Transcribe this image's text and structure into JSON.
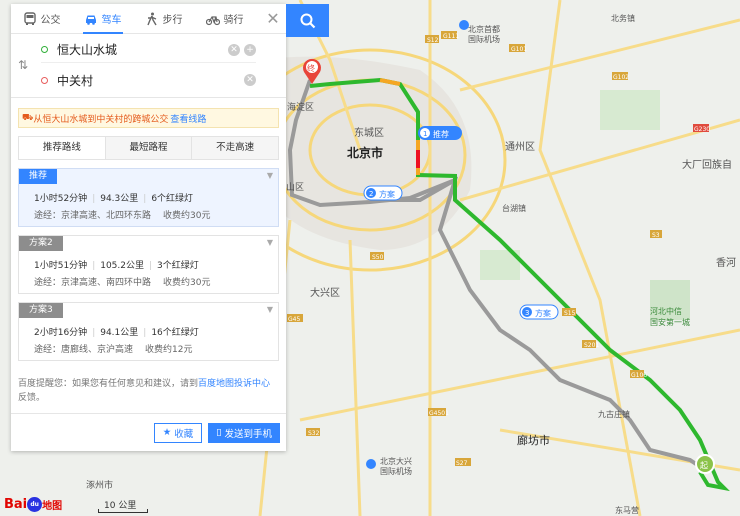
{
  "modes": [
    {
      "label": "公交",
      "icon": "bus-icon",
      "active": false
    },
    {
      "label": "驾车",
      "icon": "car-icon",
      "active": true
    },
    {
      "label": "步行",
      "icon": "walk-icon",
      "active": false
    },
    {
      "label": "骑行",
      "icon": "bike-icon",
      "active": false
    }
  ],
  "close_label": "✕",
  "search": {
    "icon": "search-icon"
  },
  "route_input": {
    "start": "恒大山水城",
    "end": "中关村",
    "start_color": "#31b03a",
    "end_color": "#e85d5d"
  },
  "notice": {
    "text": "从恒大山水城到中关村的跨城公交",
    "link": "查看线路"
  },
  "tabs": [
    "推荐路线",
    "最短路程",
    "不走高速"
  ],
  "plans": [
    {
      "tag": "推荐",
      "time": "1小时52分钟",
      "distance": "94.3公里",
      "lights": "6个红绿灯",
      "via": "途经：京津高速、北四环东路",
      "toll": "收费约30元"
    },
    {
      "tag": "方案2",
      "time": "1小时51分钟",
      "distance": "105.2公里",
      "lights": "3个红绿灯",
      "via": "途经：京津高速、南四环中路",
      "toll": "收费约30元"
    },
    {
      "tag": "方案3",
      "time": "2小时16分钟",
      "distance": "94.1公里",
      "lights": "16个红绿灯",
      "via": "途经：唐廊线、京沪高速",
      "toll": "收费约12元"
    }
  ],
  "tip": {
    "prefix": "百度提醒您：如果您有任何意见和建议，请到",
    "link": "百度地图投诉中心",
    "suffix": "反馈。"
  },
  "footer": {
    "favorite": "收藏",
    "send": "发送到手机"
  },
  "map": {
    "labels": {
      "haidian": "海淀区",
      "dongcheng": "东城区",
      "beijing": "北京市",
      "tongzhou": "通州区",
      "daxing": "大兴区",
      "langfang": "廊坊市",
      "zhuozhou": "涿州市",
      "dachang": "大厂回族自",
      "xianghe": "香河",
      "taihu": "台湖镇",
      "shouDu": "北京首都",
      "guoji": "国际机场",
      "daxingAir": "北京大兴",
      "daxingAir2": "国际机场",
      "hebei": "河北中信",
      "guoan": "国安第一城",
      "jiugu": "九古庄镇",
      "guxiang": "北务镇",
      "dongsheng": "东马营",
      "hdqu": "山区"
    },
    "markers": {
      "end": "终",
      "start": "起",
      "recommend": "推荐",
      "plan2": "方案",
      "plan3": "方案",
      "n1": "1",
      "n2": "2",
      "n3": "3"
    },
    "roads": [
      "G111",
      "G101",
      "S12",
      "S15",
      "G45",
      "S50",
      "S32",
      "G102",
      "G230",
      "S3",
      "S201",
      "G4501",
      "S27",
      "G106",
      "G105",
      "G1",
      "S31",
      "S5",
      "G3"
    ]
  },
  "logo": {
    "text": "Bai",
    "du": "du",
    "ditu": "地图"
  },
  "scale_label": "10 公里"
}
